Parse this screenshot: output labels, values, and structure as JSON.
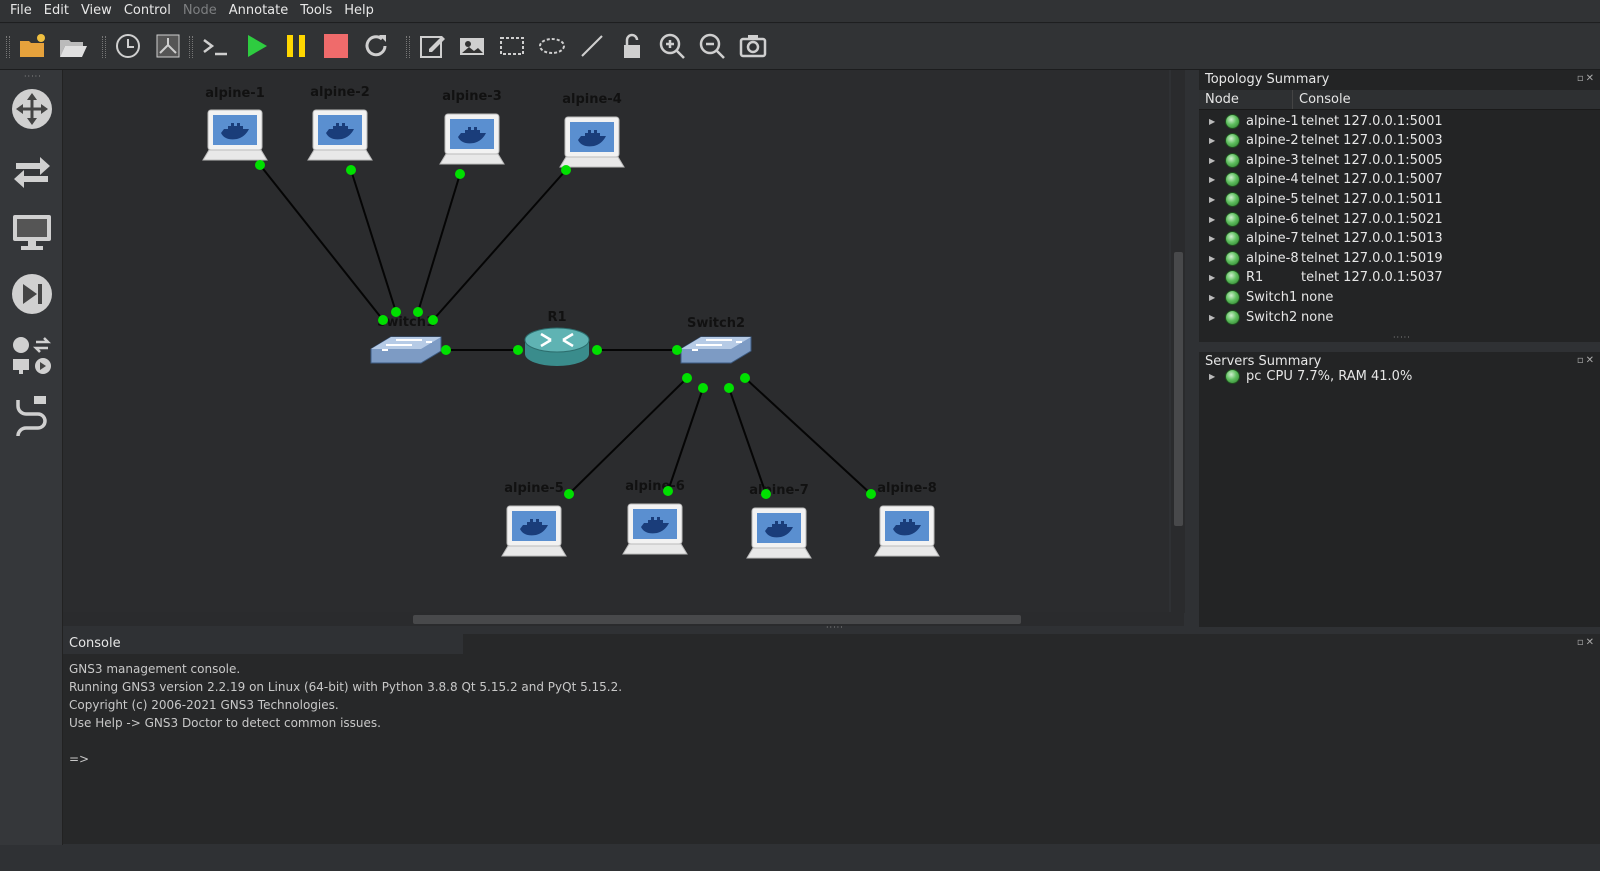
{
  "menu": [
    "File",
    "Edit",
    "View",
    "Control",
    "Node",
    "Annotate",
    "Tools",
    "Help"
  ],
  "menu_disabled": [
    "Node"
  ],
  "toolbar": [
    {
      "name": "new-project-icon",
      "color": "#f0c040"
    },
    {
      "name": "open-project-icon",
      "color": "#e0e0e0"
    },
    {
      "name": "snapshot-icon",
      "color": "#cfcfcf"
    },
    {
      "name": "show-interfaces-icon",
      "color": "#cfcfcf"
    },
    {
      "name": "console-all-icon",
      "color": "#cfcfcf"
    },
    {
      "name": "start-all-icon",
      "color": "#2ecc40"
    },
    {
      "name": "suspend-all-icon",
      "color": "#ffd700"
    },
    {
      "name": "stop-all-icon",
      "color": "#ef6b6b"
    },
    {
      "name": "reload-all-icon",
      "color": "#cfcfcf"
    },
    {
      "name": "add-note-icon",
      "color": "#cfcfcf"
    },
    {
      "name": "insert-picture-icon",
      "color": "#cfcfcf"
    },
    {
      "name": "draw-rectangle-icon",
      "color": "#cfcfcf"
    },
    {
      "name": "draw-ellipse-icon",
      "color": "#cfcfcf"
    },
    {
      "name": "draw-line-icon",
      "color": "#cfcfcf"
    },
    {
      "name": "lock-icon",
      "color": "#cfcfcf"
    },
    {
      "name": "zoom-in-icon",
      "color": "#cfcfcf"
    },
    {
      "name": "zoom-out-icon",
      "color": "#cfcfcf"
    },
    {
      "name": "screenshot-icon",
      "color": "#cfcfcf"
    }
  ],
  "dock": [
    "routers-icon",
    "switches-icon",
    "end-devices-icon",
    "security-devices-icon",
    "all-devices-icon",
    "add-link-icon"
  ],
  "topology": {
    "nodes": [
      {
        "id": "alpine-1",
        "type": "host"
      },
      {
        "id": "alpine-2",
        "type": "host"
      },
      {
        "id": "alpine-3",
        "type": "host"
      },
      {
        "id": "alpine-4",
        "type": "host"
      },
      {
        "id": "Switch1",
        "type": "switch"
      },
      {
        "id": "R1",
        "type": "router"
      },
      {
        "id": "Switch2",
        "type": "switch"
      },
      {
        "id": "alpine-5",
        "type": "host"
      },
      {
        "id": "alpine-6",
        "type": "host"
      },
      {
        "id": "alpine-7",
        "type": "host"
      },
      {
        "id": "alpine-8",
        "type": "host"
      }
    ],
    "links": [
      [
        "alpine-1",
        "Switch1"
      ],
      [
        "alpine-2",
        "Switch1"
      ],
      [
        "alpine-3",
        "Switch1"
      ],
      [
        "alpine-4",
        "Switch1"
      ],
      [
        "Switch1",
        "R1"
      ],
      [
        "R1",
        "Switch2"
      ],
      [
        "Switch2",
        "alpine-5"
      ],
      [
        "Switch2",
        "alpine-6"
      ],
      [
        "Switch2",
        "alpine-7"
      ],
      [
        "Switch2",
        "alpine-8"
      ]
    ],
    "link_status_color": "#00e000"
  },
  "topology_summary": {
    "title": "Topology Summary",
    "columns": [
      "Node",
      "Console"
    ],
    "rows": [
      {
        "node": "alpine-1",
        "console": "telnet 127.0.0.1:5001"
      },
      {
        "node": "alpine-2",
        "console": "telnet 127.0.0.1:5003"
      },
      {
        "node": "alpine-3",
        "console": "telnet 127.0.0.1:5005"
      },
      {
        "node": "alpine-4",
        "console": "telnet 127.0.0.1:5007"
      },
      {
        "node": "alpine-5",
        "console": "telnet 127.0.0.1:5011"
      },
      {
        "node": "alpine-6",
        "console": "telnet 127.0.0.1:5021"
      },
      {
        "node": "alpine-7",
        "console": "telnet 127.0.0.1:5013"
      },
      {
        "node": "alpine-8",
        "console": "telnet 127.0.0.1:5019"
      },
      {
        "node": "R1",
        "console": "telnet 127.0.0.1:5037"
      },
      {
        "node": "Switch1",
        "console": "none"
      },
      {
        "node": "Switch2",
        "console": "none"
      }
    ]
  },
  "servers_summary": {
    "title": "Servers Summary",
    "rows": [
      {
        "name": "pc",
        "stats": "CPU 7.7%, RAM 41.0%"
      }
    ]
  },
  "console": {
    "title": "Console",
    "lines": [
      "GNS3 management console.",
      "Running GNS3 version 2.2.19 on Linux (64-bit) with Python 3.8.8 Qt 5.15.2 and PyQt 5.15.2.",
      "Copyright (c) 2006-2021 GNS3 Technologies.",
      "Use Help -> GNS3 Doctor to detect common issues.",
      "",
      "=>"
    ]
  }
}
